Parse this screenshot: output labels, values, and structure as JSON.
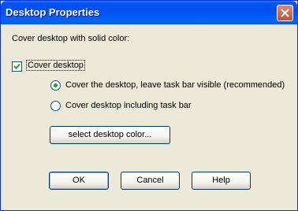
{
  "window": {
    "title": "Desktop Properties"
  },
  "content": {
    "heading": "Cover desktop with solid color:",
    "cover_checkbox": {
      "label": "Cover desktop",
      "checked": true
    },
    "options": [
      {
        "label": "Cover the desktop, leave task bar visible (recommended)",
        "selected": true
      },
      {
        "label": "Cover desktop including task bar",
        "selected": false
      }
    ],
    "select_color_button": "select desktop color..."
  },
  "buttons": {
    "ok": "OK",
    "cancel": "Cancel",
    "help": "Help"
  }
}
